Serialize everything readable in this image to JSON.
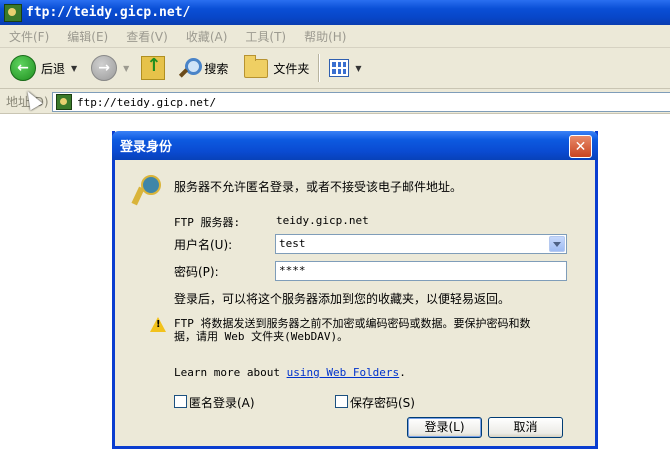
{
  "window": {
    "title": "ftp://teidy.gicp.net/"
  },
  "menu": [
    "文件(F)",
    "编辑(E)",
    "查看(V)",
    "收藏(A)",
    "工具(T)",
    "帮助(H)"
  ],
  "toolbar": {
    "back_label": "后退",
    "search_label": "搜索",
    "folders_label": "文件夹"
  },
  "address": {
    "label": "地址(D)",
    "url": "ftp://teidy.gicp.net/"
  },
  "dialog": {
    "title": "登录身份",
    "close_glyph": "✕",
    "message": "服务器不允许匿名登录，或者不接受该电子邮件地址。",
    "ftp_server_label": "FTP 服务器:",
    "ftp_server_value": "teidy.gicp.net",
    "username_label": "用户名(U):",
    "username_value": "test",
    "password_label": "密码(P):",
    "password_value": "****",
    "info": "登录后，可以将这个服务器添加到您的收藏夹，以便轻易返回。",
    "warning_line1": "FTP 将数据发送到服务器之前不加密或编码密码或数据。要保护密码和数",
    "warning_line2": "据，请用 Web 文件夹(WebDAV)。",
    "learn_more_prefix": "Learn more about ",
    "learn_more_link": "using Web Folders",
    "learn_more_suffix": ".",
    "anonymous_label": "匿名登录(A)",
    "save_password_label": "保存密码(S)",
    "login_button": "登录(L)",
    "cancel_button": "取消"
  }
}
